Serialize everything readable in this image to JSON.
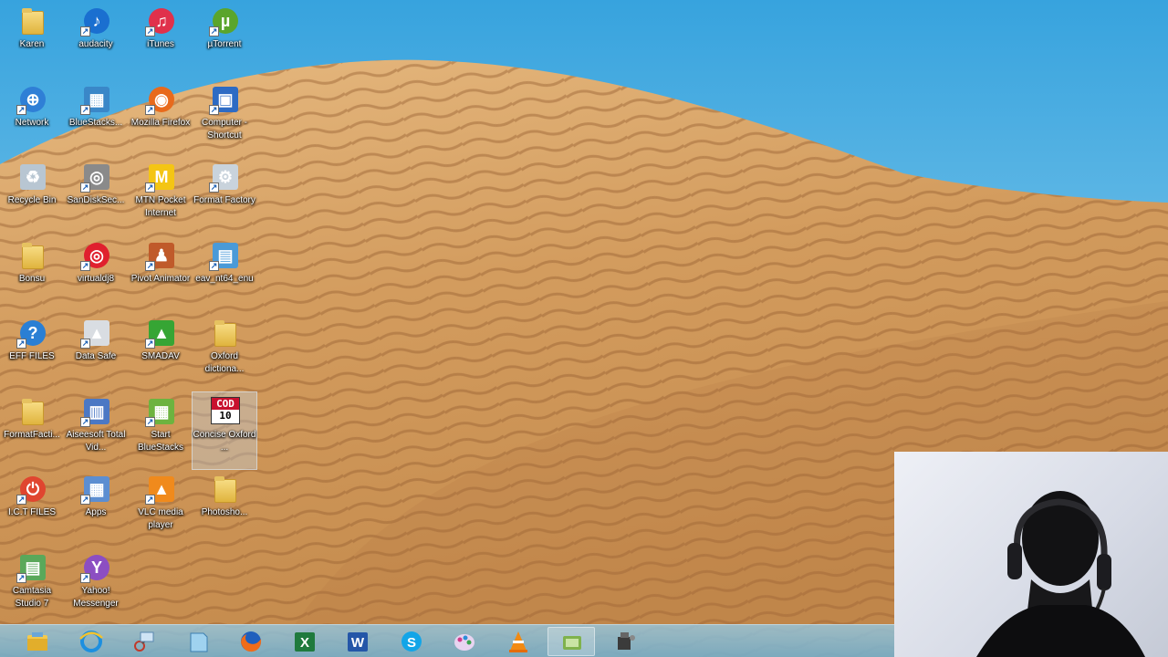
{
  "desktop": {
    "icons": [
      {
        "label": "Karen"
      },
      {
        "label": "audacity"
      },
      {
        "label": "iTunes"
      },
      {
        "label": "µTorrent"
      },
      {
        "label": "Network"
      },
      {
        "label": "BlueStacks..."
      },
      {
        "label": "Mozilla Firefox"
      },
      {
        "label": "Computer - Shortcut"
      },
      {
        "label": "Recycle Bin"
      },
      {
        "label": "SanDiskSec..."
      },
      {
        "label": "MTN Pocket Internet"
      },
      {
        "label": "Format Factory"
      },
      {
        "label": "Bonsu"
      },
      {
        "label": "virtualdj8"
      },
      {
        "label": "Pivot Animator"
      },
      {
        "label": "eav_nt64_enu"
      },
      {
        "label": "EFF FILES"
      },
      {
        "label": "Data Safe"
      },
      {
        "label": "SMADAV"
      },
      {
        "label": "Oxford dictiona..."
      },
      {
        "label": "FormatFacti..."
      },
      {
        "label": "Aiseesoft Total Vid..."
      },
      {
        "label": "Start BlueStacks"
      },
      {
        "label": "Concise Oxford ...",
        "badge_top": "COD",
        "badge_bottom": "10"
      },
      {
        "label": "I.C.T FILES"
      },
      {
        "label": "Apps"
      },
      {
        "label": "VLC media player"
      },
      {
        "label": "Photosho..."
      },
      {
        "label": "Camtasia Studio 7"
      },
      {
        "label": "Yahoo! Messenger"
      }
    ]
  },
  "taskbar": {
    "items": [
      {
        "name": "file-explorer"
      },
      {
        "name": "internet-explorer"
      },
      {
        "name": "snipping-tool"
      },
      {
        "name": "notepad"
      },
      {
        "name": "firefox"
      },
      {
        "name": "excel",
        "glyph": "X"
      },
      {
        "name": "word",
        "glyph": "W"
      },
      {
        "name": "skype",
        "glyph": "S"
      },
      {
        "name": "paint"
      },
      {
        "name": "vlc"
      },
      {
        "name": "camtasia-recorder"
      },
      {
        "name": "movie-maker"
      }
    ]
  },
  "colors": {
    "sky_top": "#3fa9e0",
    "sand_light": "#e4b47a",
    "sand_dark": "#b57a42",
    "taskbar": "#86bdd6"
  }
}
